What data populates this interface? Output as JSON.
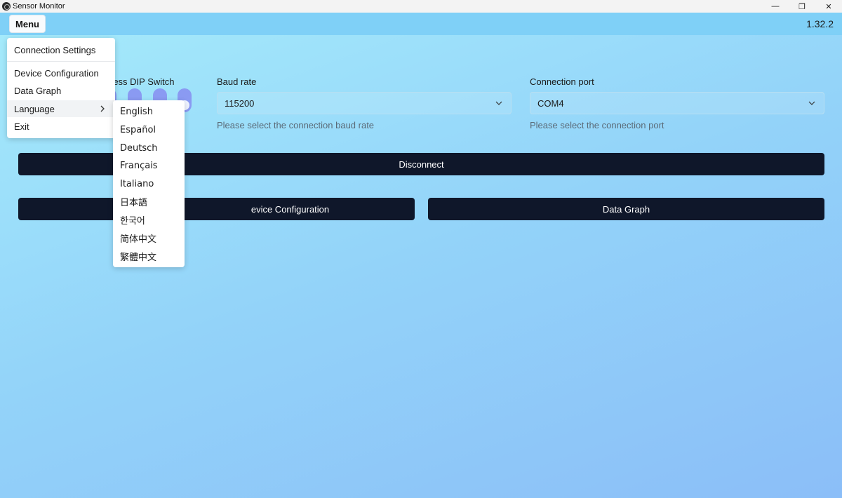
{
  "window": {
    "title": "Sensor Monitor",
    "minimize_glyph": "—",
    "restore_glyph": "❐",
    "close_glyph": "✕"
  },
  "appbar": {
    "menu_label": "Menu",
    "version": "1.32.2"
  },
  "form": {
    "dip_label": "ress DIP Switch",
    "baud": {
      "label": "Baud rate",
      "value": "115200",
      "helper": "Please select the connection baud rate"
    },
    "port": {
      "label": "Connection port",
      "value": "COM4",
      "helper": "Please select the connection port"
    },
    "disconnect_label": "Disconnect",
    "device_config_label": "evice Configuration",
    "data_graph_label": "Data Graph"
  },
  "menu": {
    "items": [
      {
        "label": "Connection Settings"
      },
      {
        "label": "Device Configuration"
      },
      {
        "label": "Data Graph"
      },
      {
        "label": "Language"
      },
      {
        "label": "Exit"
      }
    ]
  },
  "language_menu": {
    "items": [
      {
        "label": "English"
      },
      {
        "label": "Español"
      },
      {
        "label": "Deutsch"
      },
      {
        "label": "Français"
      },
      {
        "label": "Italiano"
      },
      {
        "label": "日本語"
      },
      {
        "label": "한국어"
      },
      {
        "label": "简体中文"
      },
      {
        "label": "繁體中文"
      }
    ]
  },
  "colors": {
    "accent_dark": "#0f172a",
    "dip_switch": "#8a9af2",
    "appbar": "#7fd0f7"
  }
}
